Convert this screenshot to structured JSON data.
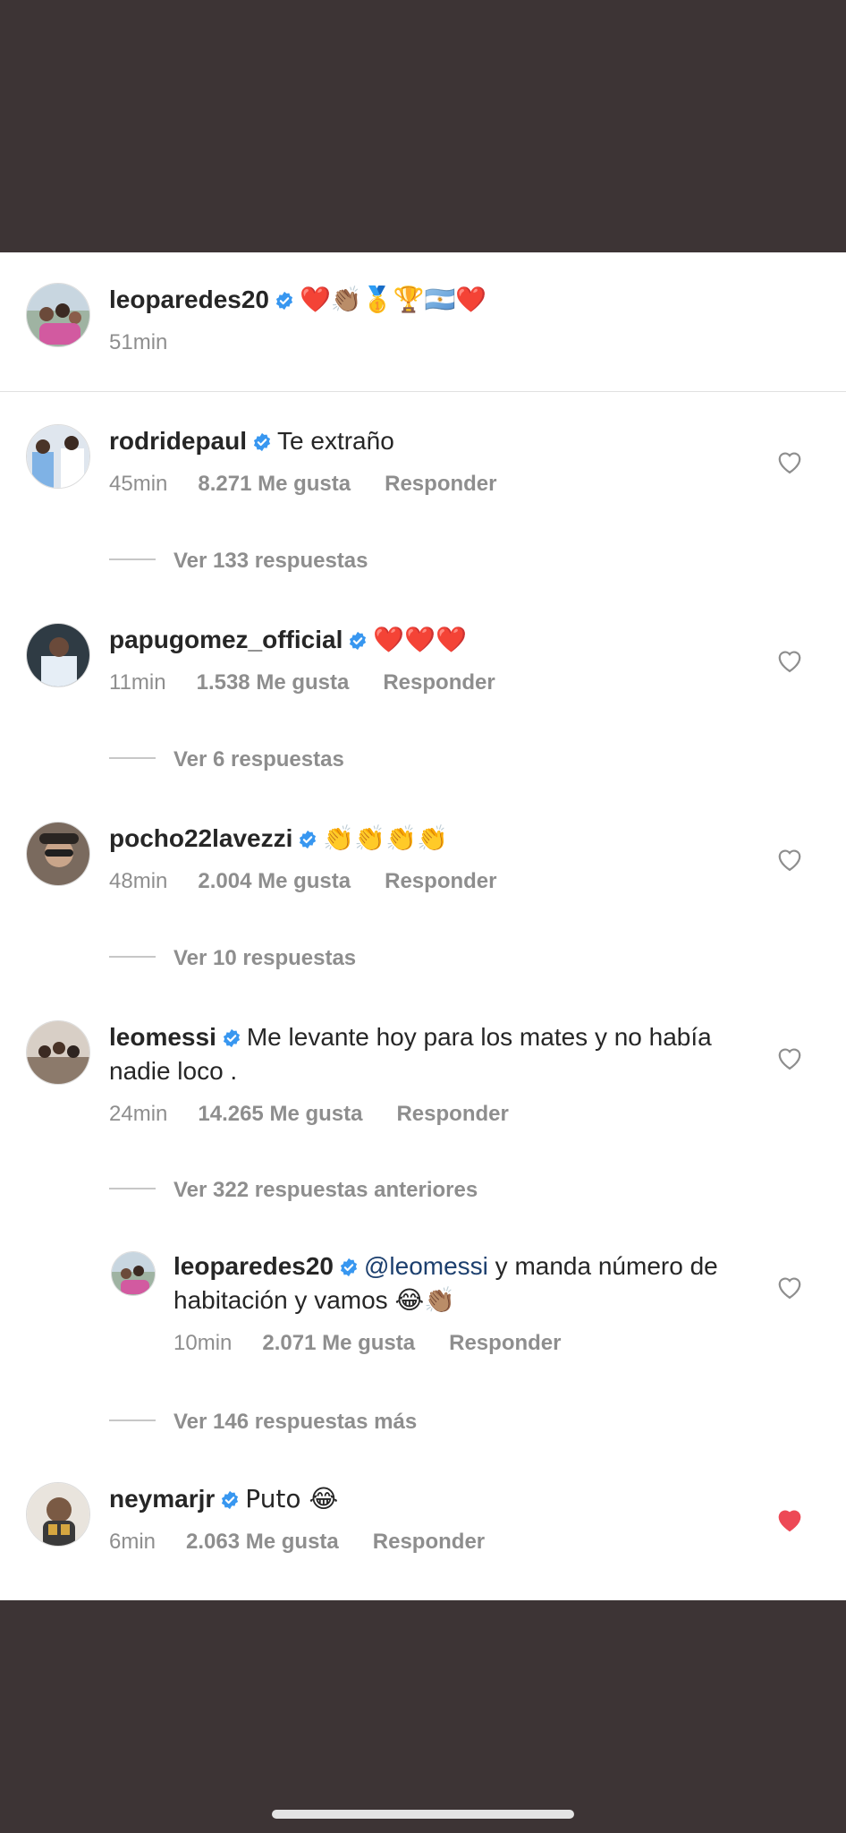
{
  "post": {
    "username": "leoparedes20",
    "caption": "❤️👏🏽🥇🏆🇦🇷❤️",
    "time": "51min"
  },
  "comments": [
    {
      "username": "rodridepaul",
      "text": "Te extraño",
      "time": "45min",
      "likes": "8.271 Me gusta",
      "reply": "Responder",
      "view_replies": "Ver 133 respuestas",
      "liked": false
    },
    {
      "username": "papugomez_official",
      "text": "❤️❤️❤️",
      "time": "11min",
      "likes": "1.538 Me gusta",
      "reply": "Responder",
      "view_replies": "Ver 6 respuestas",
      "liked": false
    },
    {
      "username": "pocho22lavezzi",
      "text": "👏👏👏👏",
      "time": "48min",
      "likes": "2.004 Me gusta",
      "reply": "Responder",
      "view_replies": "Ver 10 respuestas",
      "liked": false
    },
    {
      "username": "leomessi",
      "text": "Me levante hoy para los mates y no había nadie loco .",
      "time": "24min",
      "likes": "14.265 Me gusta",
      "reply": "Responder",
      "view_replies": "Ver 322 respuestas anteriores",
      "liked": false
    },
    {
      "username": "leoparedes20",
      "mention": "@leomessi",
      "text": " y manda número de habitación y vamos 😂👏🏽",
      "time": "10min",
      "likes": "2.071 Me gusta",
      "reply": "Responder",
      "view_replies": "Ver 146 respuestas más",
      "liked": false
    },
    {
      "username": "neymarjr",
      "text": "Puto 😂",
      "time": "6min",
      "likes": "2.063 Me gusta",
      "reply": "Responder",
      "liked": true
    }
  ],
  "colors": {
    "background": "#3d3435",
    "panel": "#ffffff",
    "verified": "#3897f0",
    "liked_heart": "#ed4956",
    "meta": "#8e8e8e"
  },
  "icons": {
    "verified": "verified-badge-icon",
    "like": "heart-outline-icon",
    "liked": "heart-filled-icon"
  }
}
